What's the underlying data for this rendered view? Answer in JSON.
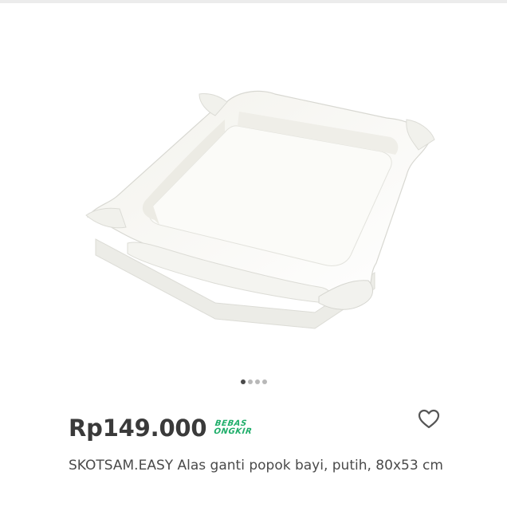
{
  "product": {
    "price": "Rp149.000",
    "badge_line1": "BEBAS",
    "badge_line2": "ONGKIR",
    "title": "SKOTSAM.EASY Alas ganti popok bayi, putih, 80x53 cm",
    "image": "white-baby-changing-pad"
  },
  "carousel": {
    "total": 4,
    "active": 1
  },
  "icons": {
    "wishlist": "heart-outline-icon"
  },
  "colors": {
    "price": "#3a3a3a",
    "badge": "#1fae6a",
    "dot_active": "#4a4a4a",
    "dot_inactive": "#b8b8b8"
  }
}
